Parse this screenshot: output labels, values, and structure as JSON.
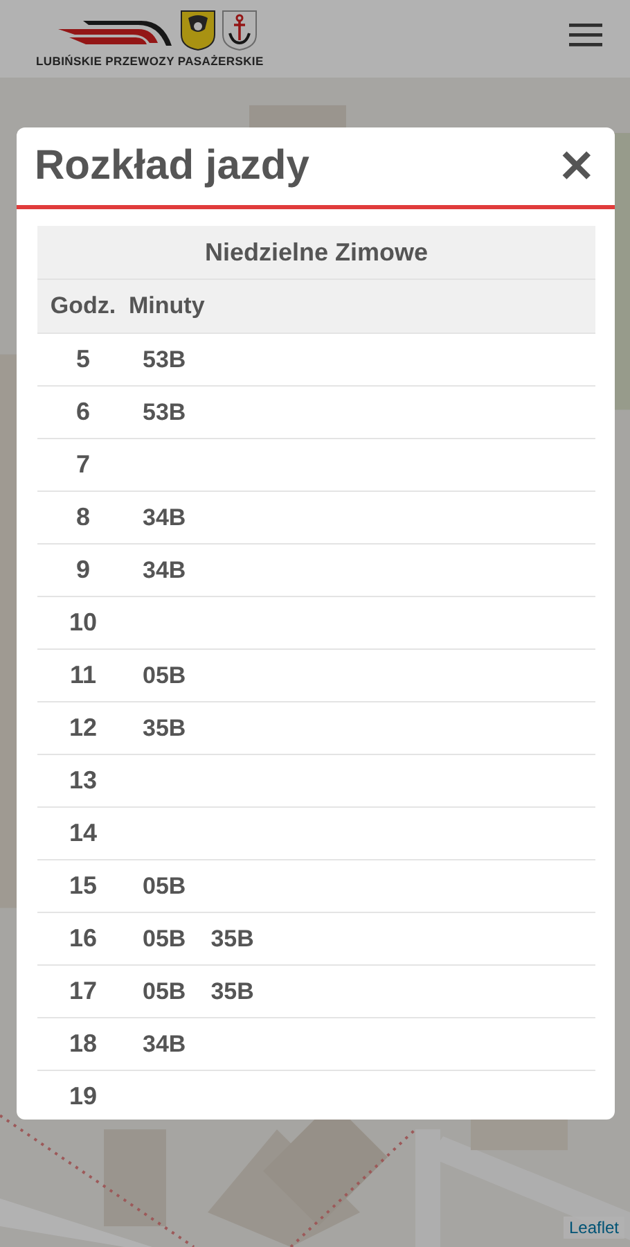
{
  "header": {
    "logo_text": "LUBIŃSKIE PRZEWOZY PASAŻERSKIE"
  },
  "map": {
    "kind": "picture",
    "attribution": "Leaflet"
  },
  "modal": {
    "title": "Rozkład jazdy",
    "close": "✕",
    "table": {
      "caption": "Niedzielne Zimowe",
      "columns": [
        "Godz.",
        "Minuty"
      ],
      "rows": [
        {
          "hour": "5",
          "minutes": [
            "53B"
          ]
        },
        {
          "hour": "6",
          "minutes": [
            "53B"
          ]
        },
        {
          "hour": "7",
          "minutes": []
        },
        {
          "hour": "8",
          "minutes": [
            "34B"
          ]
        },
        {
          "hour": "9",
          "minutes": [
            "34B"
          ]
        },
        {
          "hour": "10",
          "minutes": []
        },
        {
          "hour": "11",
          "minutes": [
            "05B"
          ]
        },
        {
          "hour": "12",
          "minutes": [
            "35B"
          ]
        },
        {
          "hour": "13",
          "minutes": []
        },
        {
          "hour": "14",
          "minutes": []
        },
        {
          "hour": "15",
          "minutes": [
            "05B"
          ]
        },
        {
          "hour": "16",
          "minutes": [
            "05B",
            "35B"
          ]
        },
        {
          "hour": "17",
          "minutes": [
            "05B",
            "35B"
          ]
        },
        {
          "hour": "18",
          "minutes": [
            "34B"
          ]
        },
        {
          "hour": "19",
          "minutes": []
        }
      ]
    }
  }
}
